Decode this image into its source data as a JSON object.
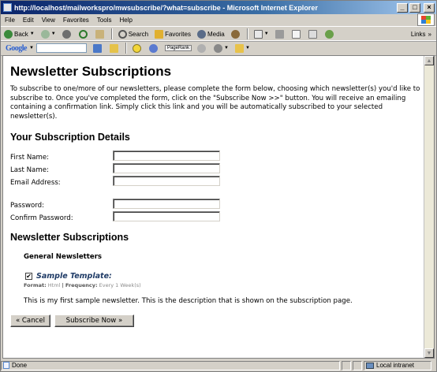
{
  "window": {
    "title": "http://localhost/mailworkspro/mwsubscribe/?what=subscribe - Microsoft Internet Explorer",
    "controls": {
      "minimize": "_",
      "maximize": "□",
      "close": "×"
    }
  },
  "menubar": {
    "items": [
      {
        "key": "F",
        "rest": "ile"
      },
      {
        "key": "E",
        "rest": "dit"
      },
      {
        "key": "V",
        "rest": "iew"
      },
      {
        "key": "F",
        "rest": "avorites",
        "prefix": ""
      },
      {
        "key": "T",
        "rest": "ools"
      },
      {
        "key": "H",
        "rest": "elp"
      }
    ],
    "labels": [
      "File",
      "Edit",
      "View",
      "Favorites",
      "Tools",
      "Help"
    ]
  },
  "nav_toolbar": {
    "back": "Back",
    "search": "Search",
    "favorites": "Favorites",
    "media": "Media",
    "links": "Links",
    "links_chevron": "»",
    "icons": [
      "back-icon",
      "forward-icon",
      "stop-icon",
      "refresh-icon",
      "home-icon",
      "search-icon",
      "favorites-icon",
      "media-icon",
      "history-icon",
      "mail-icon",
      "print-icon",
      "edit-icon",
      "discuss-icon",
      "messenger-icon"
    ]
  },
  "google_toolbar": {
    "logo": "Google",
    "pagerank": "PageRank",
    "icons": [
      "search-web-icon",
      "search-site-icon",
      "smiley-icon",
      "info-icon",
      "pagerank-icon",
      "highlight-icon",
      "options-icon"
    ]
  },
  "page": {
    "title": "Newsletter Subscriptions",
    "intro": "To subscribe to one/more of our newsletters, please complete the form below, choosing which newsletter(s) you'd like to subscribe to. Once you've completed the form, click on the \"Subscribe Now >>\" button. You will receive an emailing containing a confirmation link. Simply click this link and you will be automatically subscribed to your selected newsletter(s).",
    "details_heading": "Your Subscription Details",
    "fields": {
      "first_name": {
        "label": "First Name:",
        "value": ""
      },
      "last_name": {
        "label": "Last Name:",
        "value": ""
      },
      "email": {
        "label": "Email Address:",
        "value": ""
      },
      "password": {
        "label": "Password:",
        "value": ""
      },
      "confirm_password": {
        "label": "Confirm Password:",
        "value": ""
      }
    },
    "subscriptions_heading": "Newsletter Subscriptions",
    "group_label": "General Newsletters",
    "newsletter": {
      "checked": true,
      "check_mark": "✔",
      "name": "Sample Template:",
      "format_label": "Format:",
      "format_value": "Html",
      "separator": "|",
      "frequency_label": "Frequency:",
      "frequency_value": "Every 1 Week(s)",
      "description": "This is my first sample newsletter. This is the description that is shown on the subscription page."
    },
    "buttons": {
      "cancel": "« Cancel",
      "subscribe": "Subscribe Now »"
    }
  },
  "statusbar": {
    "status": "Done",
    "zone": "Local intranet"
  },
  "colors": {
    "title_bar": "#0a246a",
    "chrome": "#d4d0c8",
    "template_name": "#1f3b66"
  }
}
